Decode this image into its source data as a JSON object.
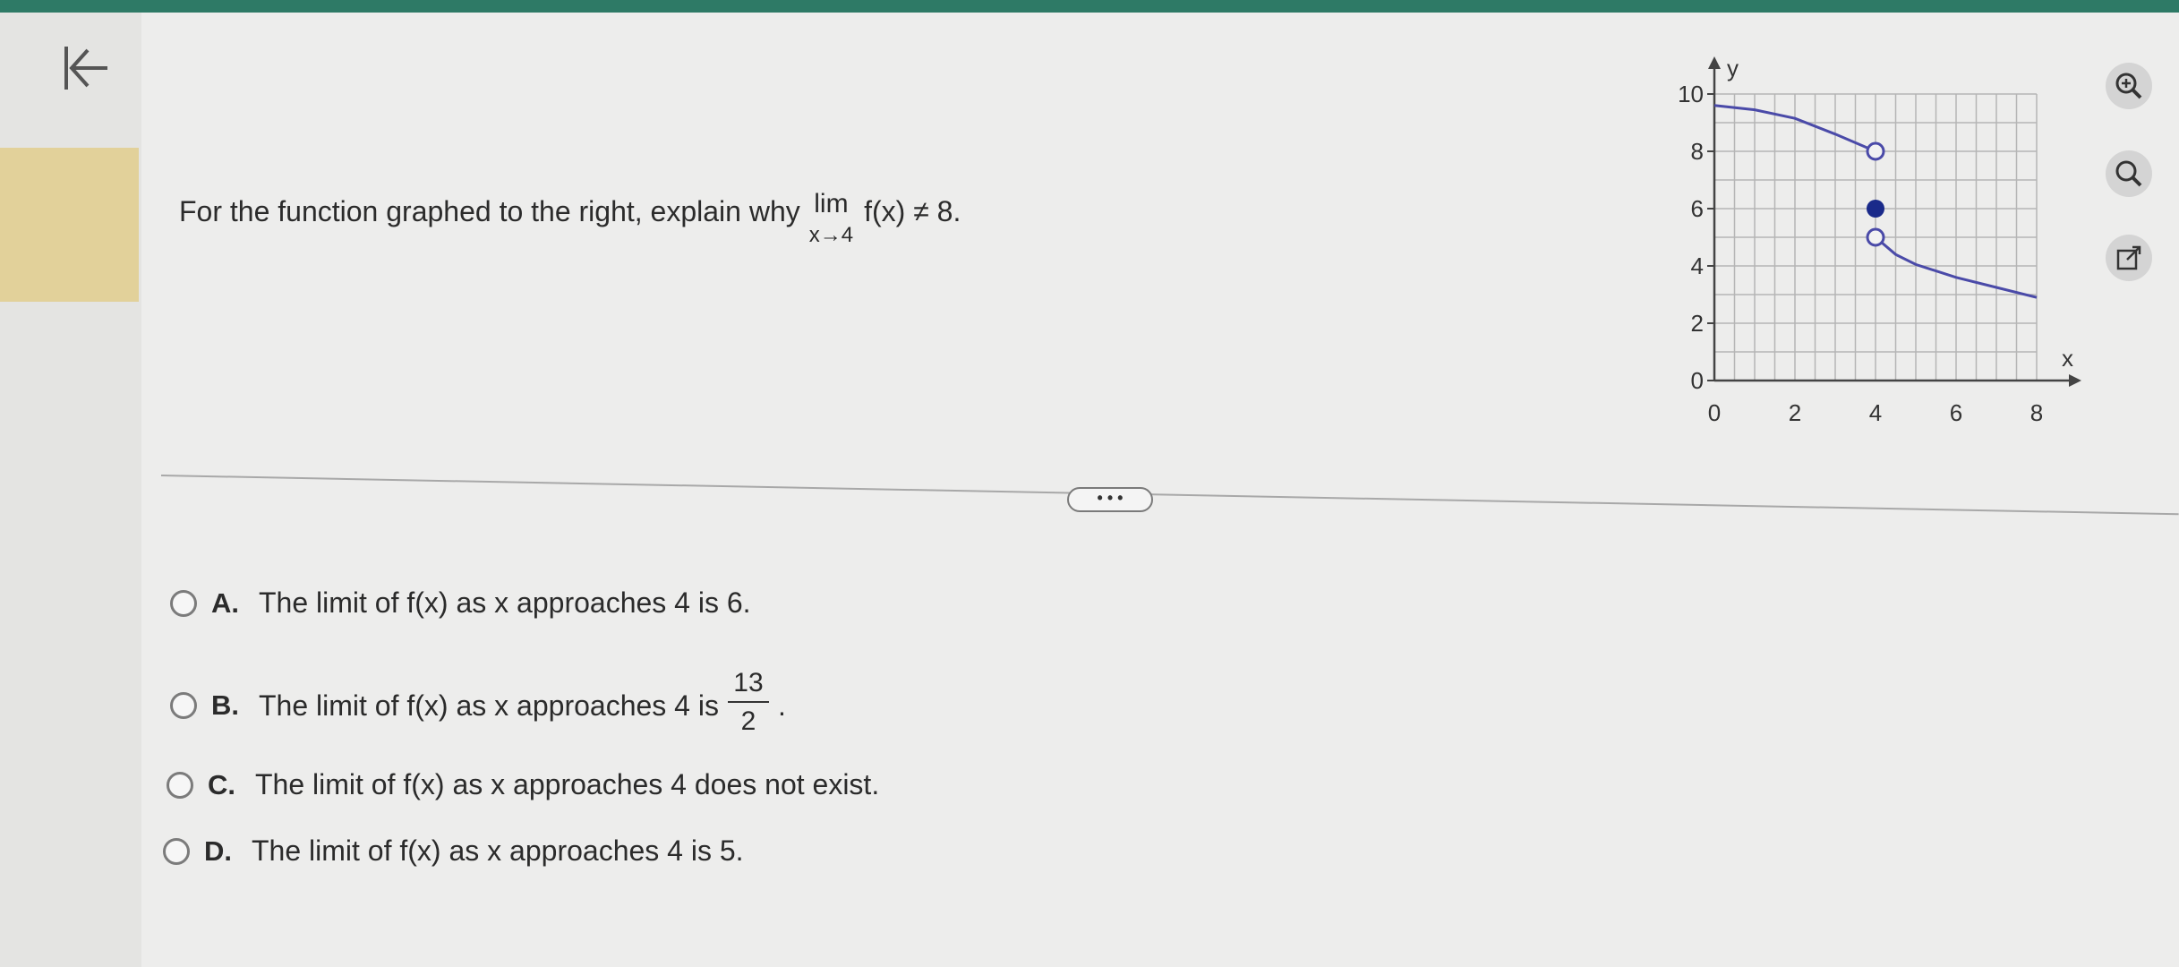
{
  "question": {
    "prefix": "For the function graphed to the right, explain why",
    "lim_word": "lim",
    "lim_sub": "x→4",
    "suffix": "f(x) ≠ 8."
  },
  "more_button": "• • •",
  "options": [
    {
      "letter": "A.",
      "text": "The limit of f(x) as x approaches 4 is 6."
    },
    {
      "letter": "B.",
      "text_before": "The limit of f(x) as x approaches 4 is",
      "frac_num": "13",
      "frac_den": "2",
      "text_after": "."
    },
    {
      "letter": "C.",
      "text": "The limit of f(x) as x approaches 4 does not exist."
    },
    {
      "letter": "D.",
      "text": "The limit of f(x) as x approaches 4 is 5."
    }
  ],
  "graph": {
    "x_label": "x",
    "y_label": "y",
    "x_ticks": [
      "0",
      "2",
      "4",
      "6",
      "8"
    ],
    "y_ticks": [
      "0",
      "2",
      "4",
      "6",
      "8",
      "10"
    ],
    "curve_color": "#4a4aa8",
    "dot_color": "#1a2a8a",
    "curve_left": [
      [
        0,
        9.6
      ],
      [
        1,
        9.45
      ],
      [
        2,
        9.15
      ],
      [
        3,
        8.6
      ],
      [
        3.5,
        8.3
      ],
      [
        4,
        8
      ]
    ],
    "curve_right": [
      [
        4,
        5
      ],
      [
        4.5,
        4.4
      ],
      [
        5,
        4.05
      ],
      [
        6,
        3.6
      ],
      [
        7,
        3.25
      ],
      [
        8,
        2.9
      ]
    ],
    "open_points": [
      [
        4,
        8
      ],
      [
        4,
        5
      ]
    ],
    "closed_point": [
      4,
      6
    ]
  },
  "side_icons": [
    "zoom-in-icon",
    "zoom-out-icon",
    "external-link-icon"
  ]
}
